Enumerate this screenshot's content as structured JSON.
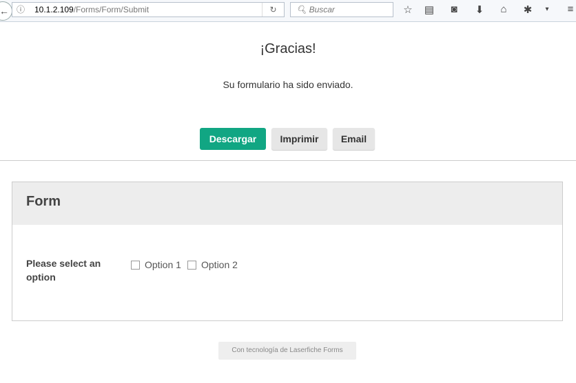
{
  "browser": {
    "url_host": "10.1.2.109",
    "url_path": "/Forms/Form/Submit",
    "search_placeholder": "Buscar"
  },
  "page": {
    "title": "¡Gracias!",
    "message": "Su formulario ha sido enviado.",
    "buttons": {
      "download": "Descargar",
      "print": "Imprimir",
      "email": "Email"
    }
  },
  "form": {
    "title": "Form",
    "field_label": "Please select an option",
    "options": [
      "Option 1",
      "Option 2"
    ]
  },
  "footer": "Con tecnología de Laserfiche Forms",
  "colors": {
    "primary": "#11a683"
  }
}
